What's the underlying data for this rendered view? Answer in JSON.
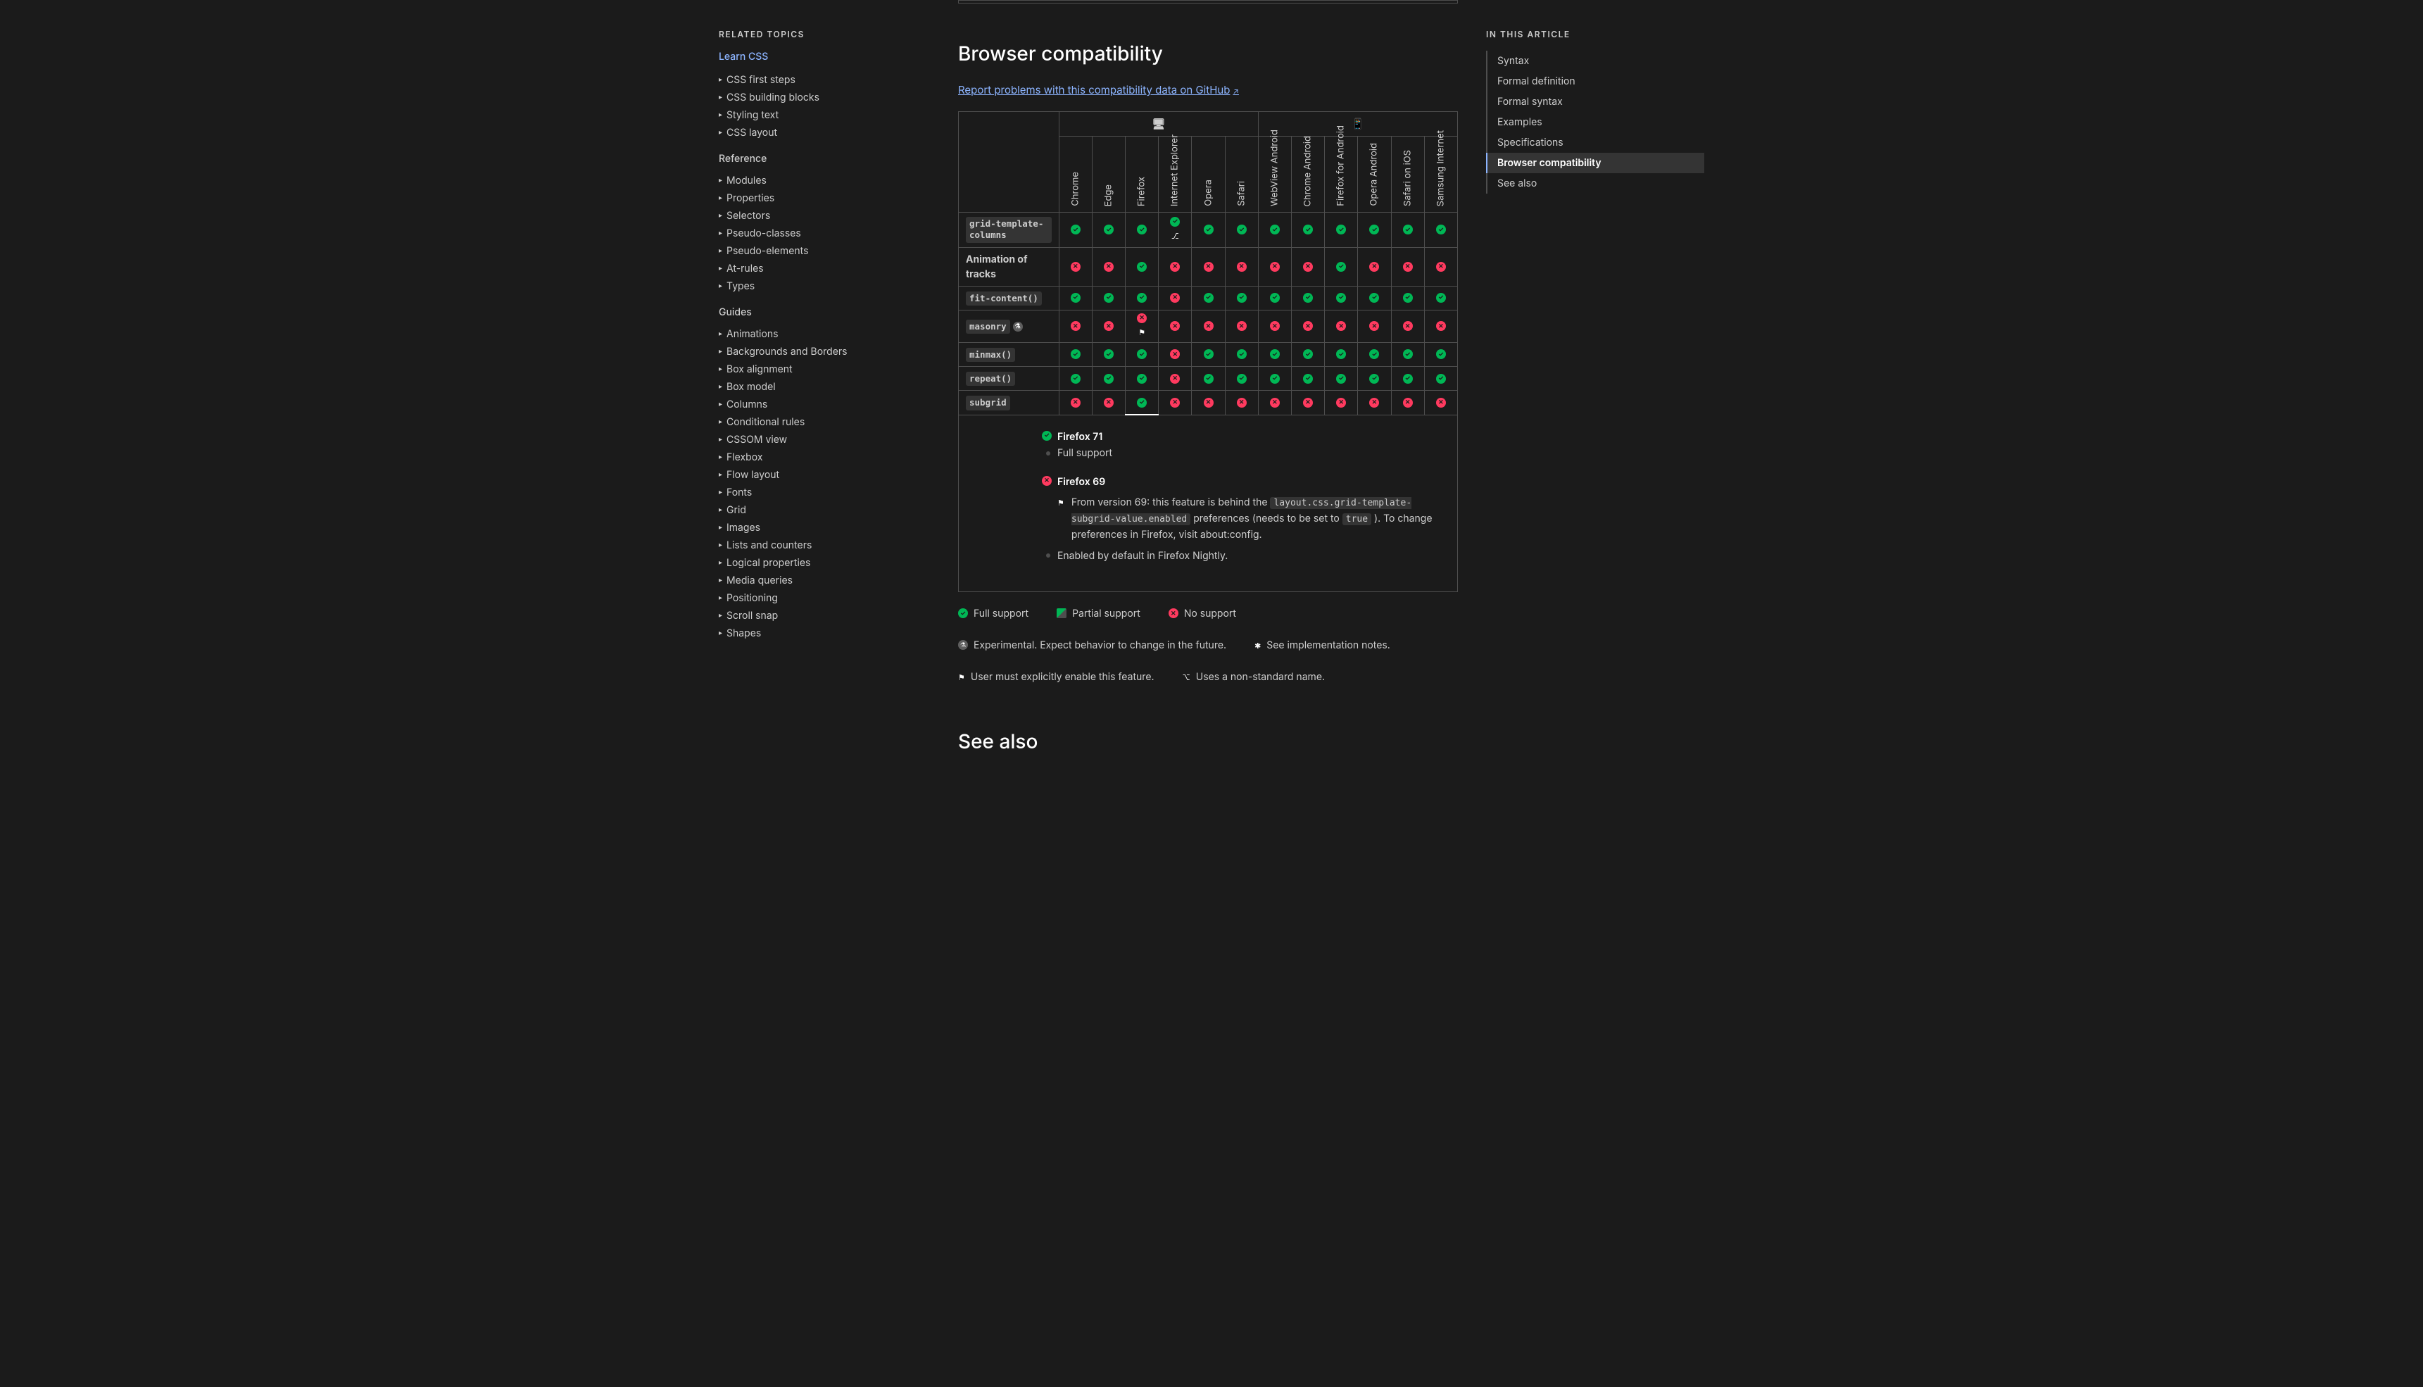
{
  "sidebar": {
    "related_heading": "Related Topics",
    "learn_link": "Learn CSS",
    "learn_items": [
      "CSS first steps",
      "CSS building blocks",
      "Styling text",
      "CSS layout"
    ],
    "reference_title": "Reference",
    "reference_items": [
      "Modules",
      "Properties",
      "Selectors",
      "Pseudo-classes",
      "Pseudo-elements",
      "At-rules",
      "Types"
    ],
    "guides_title": "Guides",
    "guides_items": [
      "Animations",
      "Backgrounds and Borders",
      "Box alignment",
      "Box model",
      "Columns",
      "Conditional rules",
      "CSSOM view",
      "Flexbox",
      "Flow layout",
      "Fonts",
      "Grid",
      "Images",
      "Lists and counters",
      "Logical properties",
      "Media queries",
      "Positioning",
      "Scroll snap",
      "Shapes"
    ]
  },
  "main": {
    "compat_title": "Browser compatibility",
    "report_link": "Report problems with this compatibility data on GitHub",
    "see_also_title": "See also"
  },
  "toc": {
    "heading": "In this article",
    "items": [
      "Syntax",
      "Formal definition",
      "Formal syntax",
      "Examples",
      "Specifications",
      "Browser compatibility",
      "See also"
    ],
    "active_index": 5
  },
  "browsers": [
    "Chrome",
    "Edge",
    "Firefox",
    "Internet Explorer",
    "Opera",
    "Safari",
    "WebView Android",
    "Chrome Android",
    "Firefox for Android",
    "Opera Android",
    "Safari on iOS",
    "Samsung Internet"
  ],
  "features": [
    {
      "label": "grid-template-columns",
      "code": true,
      "cells": [
        "y",
        "y",
        "y",
        "yp",
        "y",
        "y",
        "y",
        "y",
        "y",
        "y",
        "y",
        "y"
      ]
    },
    {
      "label": "Animation of tracks",
      "code": false,
      "cells": [
        "n",
        "n",
        "y",
        "n",
        "n",
        "n",
        "n",
        "n",
        "y",
        "n",
        "n",
        "n"
      ]
    },
    {
      "label": "fit-content()",
      "code": true,
      "cells": [
        "y",
        "y",
        "y",
        "n",
        "y",
        "y",
        "y",
        "y",
        "y",
        "y",
        "y",
        "y"
      ]
    },
    {
      "label": "masonry",
      "code": true,
      "experimental": true,
      "cells": [
        "n",
        "n",
        "nf",
        "n",
        "n",
        "n",
        "n",
        "n",
        "n",
        "n",
        "n",
        "n"
      ]
    },
    {
      "label": "minmax()",
      "code": true,
      "cells": [
        "y",
        "y",
        "y",
        "n",
        "y",
        "y",
        "y",
        "y",
        "y",
        "y",
        "y",
        "y"
      ]
    },
    {
      "label": "repeat()",
      "code": true,
      "cells": [
        "y",
        "y",
        "y",
        "n",
        "y",
        "y",
        "y",
        "y",
        "y",
        "y",
        "y",
        "y"
      ]
    },
    {
      "label": "subgrid",
      "code": true,
      "active": true,
      "cells": [
        "n",
        "n",
        "y",
        "n",
        "n",
        "n",
        "n",
        "n",
        "n",
        "n",
        "n",
        "n"
      ]
    }
  ],
  "details": {
    "entries": [
      {
        "version": "Firefox 71",
        "support": "Full support",
        "badge": "yes"
      },
      {
        "version": "Firefox 69",
        "badge": "no",
        "prefix": "From version 69: this feature is behind the ",
        "pref": "layout.css.grid-template-subgrid-value.enabled",
        "mid": " preferences (needs to be set to ",
        "val": "true",
        "suffix": " ). To change preferences in Firefox, visit about:config.",
        "enabled": "Enabled by default in Firefox Nightly."
      }
    ]
  },
  "legend": {
    "full": "Full support",
    "partial": "Partial support",
    "none": "No support",
    "experimental": "Experimental. Expect behavior to change in the future.",
    "notes": "See implementation notes.",
    "flag": "User must explicitly enable this feature.",
    "nonstd": "Uses a non-standard name."
  }
}
